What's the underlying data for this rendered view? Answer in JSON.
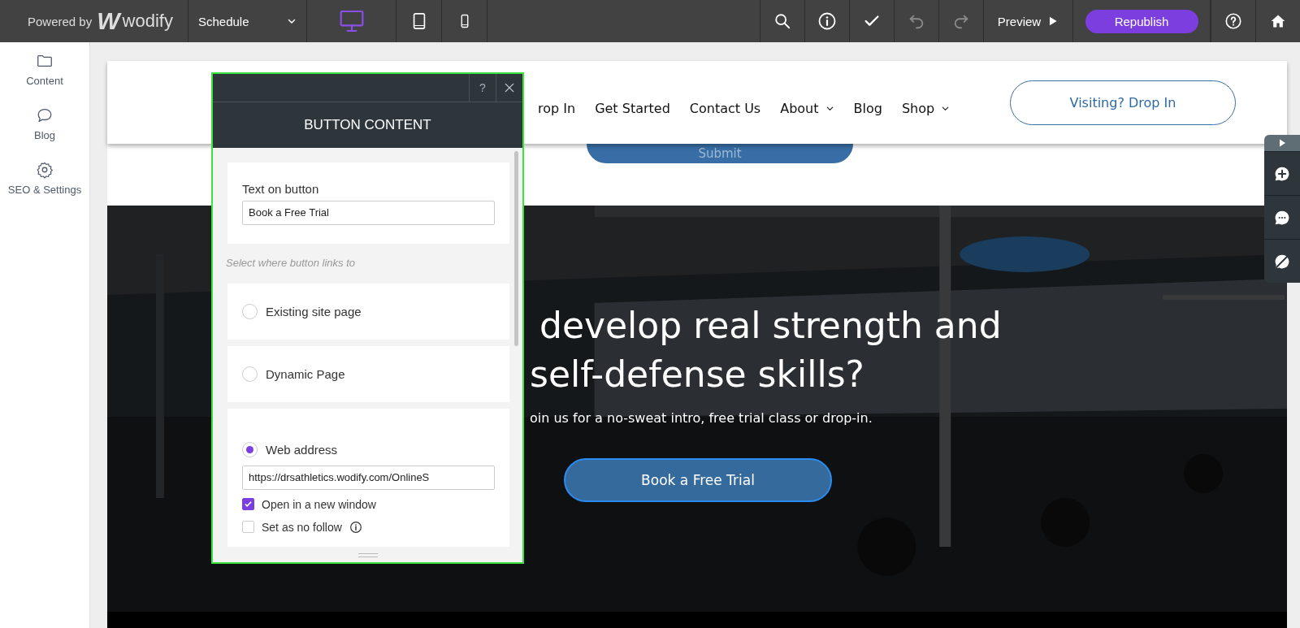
{
  "top_bar": {
    "brand": {
      "prefix": "Powered by",
      "mark": "W",
      "name": "wodify"
    },
    "page_select": {
      "value": "Schedule"
    },
    "devices": [
      {
        "kind": "desktop",
        "selected": true
      },
      {
        "kind": "tablet",
        "selected": false
      },
      {
        "kind": "mobile",
        "selected": false
      }
    ],
    "tools": [
      {
        "kind": "search",
        "disabled": false
      },
      {
        "kind": "info",
        "disabled": false
      },
      {
        "kind": "check",
        "disabled": false
      },
      {
        "kind": "undo",
        "disabled": true
      },
      {
        "kind": "redo",
        "disabled": true
      }
    ],
    "preview": "Preview",
    "publish": "Republish"
  },
  "sidebar": {
    "items": [
      {
        "kind": "folder",
        "label": "Content"
      },
      {
        "kind": "chat",
        "label": "Blog"
      },
      {
        "kind": "gear",
        "label": "SEO & Settings"
      }
    ]
  },
  "site": {
    "nav": [
      {
        "label": "rop In",
        "has_menu": false
      },
      {
        "label": "Get Started",
        "has_menu": false
      },
      {
        "label": "Contact Us",
        "has_menu": false
      },
      {
        "label": "About",
        "has_menu": true
      },
      {
        "label": "Blog",
        "has_menu": false
      },
      {
        "label": "Shop",
        "has_menu": true
      }
    ],
    "cta": "Visiting? Drop In",
    "submit": "Submit",
    "hero": {
      "kind": "picture",
      "title_lines": [
        "develop real strength and",
        "self-defense skills?"
      ],
      "subtitle": "oin us for a no-sweat intro, free trial class or drop-in.",
      "button": "Book a Free Trial"
    }
  },
  "dialog": {
    "help": "?",
    "title": "BUTTON CONTENT",
    "text_label": "Text on button",
    "text_value": "Book a Free Trial",
    "hint": "Select where button links to",
    "link_options": [
      {
        "label": "Existing site page",
        "selected": false
      },
      {
        "label": "Dynamic Page",
        "selected": false
      },
      {
        "label": "Web address",
        "selected": true,
        "url": "https://drsathletics.wodify.com/OnlineS",
        "checks": [
          {
            "label": "Open in a new window",
            "checked": true,
            "info": false
          },
          {
            "label": "Set as no follow",
            "checked": false,
            "info": true
          }
        ]
      }
    ]
  },
  "side_tools": [
    {
      "kind": "play"
    },
    {
      "kind": "add-comment"
    },
    {
      "kind": "comments"
    },
    {
      "kind": "hide-comments"
    }
  ]
}
